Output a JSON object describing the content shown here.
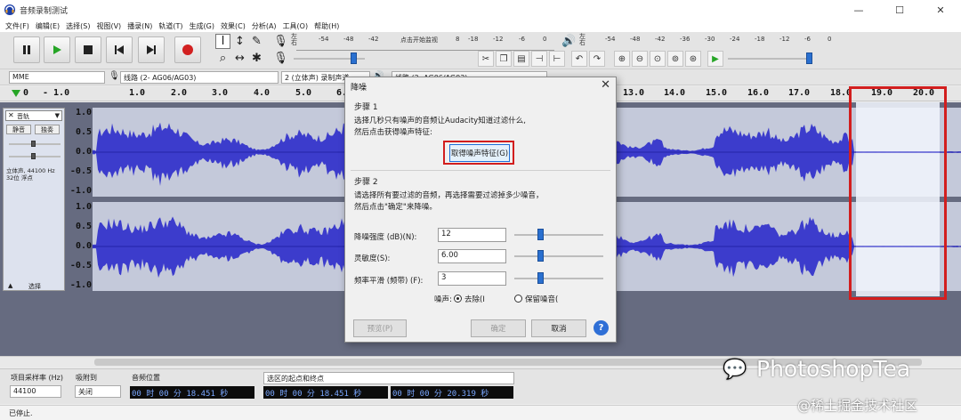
{
  "window": {
    "title": "音频录制测试",
    "minimize": "—",
    "maximize": "☐",
    "close": "✕"
  },
  "menu": [
    "文件(F)",
    "编辑(E)",
    "选择(S)",
    "视图(V)",
    "播录(N)",
    "轨道(T)",
    "生成(G)",
    "效果(C)",
    "分析(A)",
    "工具(O)",
    "帮助(H)"
  ],
  "toolbar": {
    "record_meter_ticks": [
      "-54",
      "-48",
      "-42",
      "点击开始监视",
      "8",
      "-18",
      "-12",
      "-6",
      "0"
    ],
    "play_meter_ticks": [
      "-54",
      "-48",
      "-42",
      "-36",
      "-30",
      "-24",
      "-18",
      "-12",
      "-6",
      "0"
    ],
    "meter_lr": [
      "左",
      "右"
    ]
  },
  "devices": {
    "host": "MME",
    "input": "线路 (2- AG06/AG03)",
    "channels": "2 (立体声) 录制声道",
    "output": "线路 (2- AG06/AG03)"
  },
  "timeline": {
    "ticks": [
      "0",
      "- 1.0",
      "1.0",
      "2.0",
      "3.0",
      "4.0",
      "5.0",
      "6.0",
      "13.0",
      "14.0",
      "15.0",
      "16.0",
      "17.0",
      "18.0",
      "19.0",
      "20.0"
    ]
  },
  "track": {
    "name": "音轨",
    "mute": "静音",
    "solo": "独奏",
    "info": "立体声, 44100 Hz\n32位 浮点",
    "select": "选择",
    "scale": [
      "1.0",
      "0.5",
      "0.0",
      "-0.5",
      "-1.0"
    ]
  },
  "dialog": {
    "title": "降噪",
    "close": "✕",
    "step1_title": "步骤 1",
    "step1_line1": "选择几秒只有噪声的音频让Audacity知道过滤什么,",
    "step1_line2": "然后点击获得噪声特征:",
    "get_profile_button": "取得噪声特征(G)",
    "step2_title": "步骤 2",
    "step2_line1": "请选择所有要过滤的音频，再选择需要过滤掉多少噪音，",
    "step2_line2": "然后点击\"确定\"来降噪。",
    "params": [
      {
        "label": "降噪强度 (dB)(N):",
        "value": "12",
        "level": 0.35
      },
      {
        "label": "灵敏度(S):",
        "value": "6.00",
        "level": 0.35
      },
      {
        "label": "频率平滑 (频带) (F):",
        "value": "3",
        "level": 0.35
      }
    ],
    "noise_label": "噪声:",
    "opt_remove": "去除(I",
    "opt_keep": "保留噪音(",
    "preview_button": "预览(P)",
    "ok_button": "确定",
    "cancel_button": "取消",
    "help_button": "?"
  },
  "selection_bar": {
    "rate_label": "项目采样率 (Hz)",
    "rate_value": "44100",
    "snap_label": "吸附到",
    "snap_value": "关闭",
    "pos_label": "音频位置",
    "pos_value": "00 时 00 分 18.451 秒",
    "sel_label": "选区的起点和终点",
    "sel_start": "00 时 00 分 18.451 秒",
    "sel_end": "00 时 00 分 20.319 秒"
  },
  "status": "已停止.",
  "watermark": {
    "text": "PhotoshopTea",
    "sub": "@稀土掘金技术社区"
  },
  "colors": {
    "waveform": "#3c3ccc",
    "waveform_dark": "#2323a8",
    "highlight": "#d21e1e",
    "selection": "#e6ecf8",
    "track_bg": "#c4c9da",
    "play": "#26a526",
    "record": "#d22121"
  }
}
